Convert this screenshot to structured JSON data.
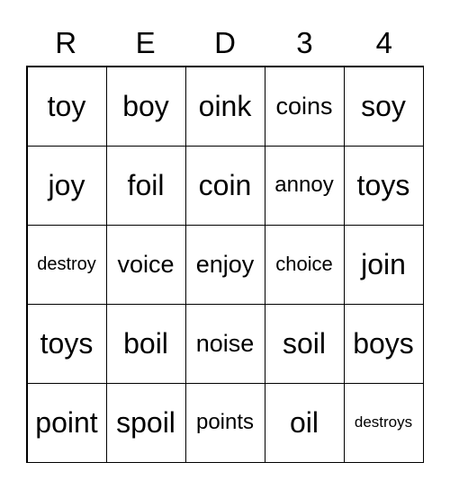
{
  "header": [
    "R",
    "E",
    "D",
    "3",
    "4"
  ],
  "cells": [
    [
      "toy",
      "boy",
      "oink",
      "coins",
      "soy"
    ],
    [
      "joy",
      "foil",
      "coin",
      "annoy",
      "toys"
    ],
    [
      "destroy",
      "voice",
      "enjoy",
      "choice",
      "join"
    ],
    [
      "toys",
      "boil",
      "noise",
      "soil",
      "boys"
    ],
    [
      "point",
      "spoil",
      "points",
      "oil",
      "destroys"
    ]
  ]
}
